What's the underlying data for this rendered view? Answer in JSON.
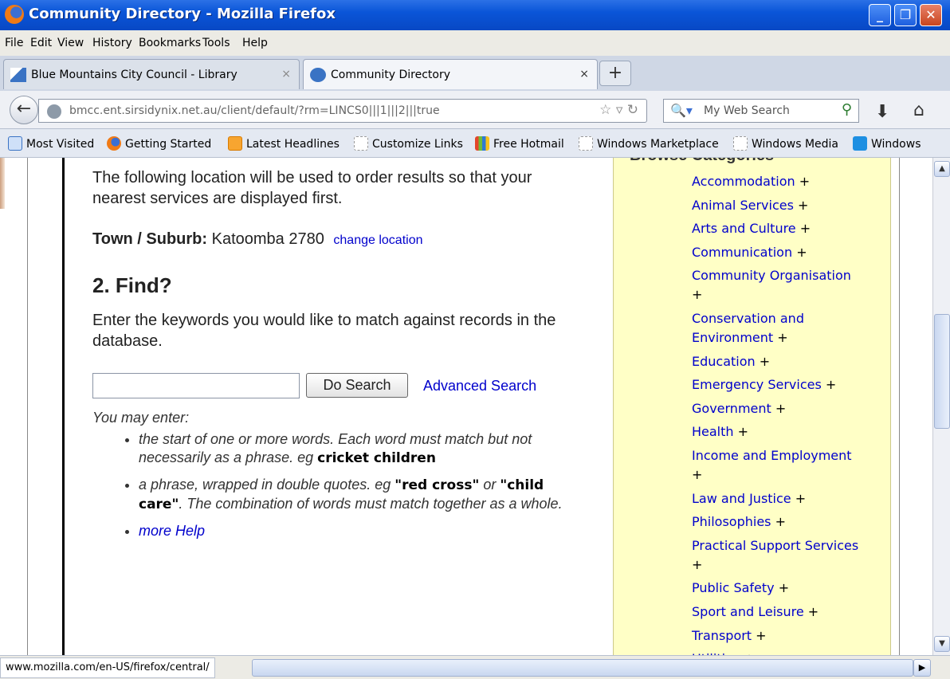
{
  "window": {
    "title": "Community Directory - Mozilla Firefox"
  },
  "menu": [
    "File",
    "Edit",
    "View",
    "History",
    "Bookmarks",
    "Tools",
    "Help"
  ],
  "tabs": [
    {
      "label": "Blue Mountains City Council - Library"
    },
    {
      "label": "Community Directory"
    }
  ],
  "nav": {
    "url": "bmcc.ent.sirsidynix.net.au/client/default/?rm=LINCS0|||1|||2|||true",
    "search_placeholder": "My Web Search"
  },
  "bookmarks": [
    "Most Visited",
    "Getting Started",
    "Latest Headlines",
    "Customize Links",
    "Free Hotmail",
    "Windows Marketplace",
    "Windows Media",
    "Windows"
  ],
  "main": {
    "intro": "The following location will be used to order results so that your nearest services are displayed first.",
    "town_label": "Town / Suburb:",
    "town_value": "Katoomba 2780",
    "change_location": "change location",
    "find_heading": "2. Find?",
    "find_text": "Enter the keywords you would like to match against records in the database.",
    "search_value": "",
    "do_search": "Do Search",
    "advanced": "Advanced Search",
    "you_may_enter": "You may enter:",
    "help": {
      "b1_text": "the start of one or more words. Each word must match but not necessarily as a phrase. eg ",
      "b1_example": "cricket children",
      "b2_text": "a phrase, wrapped in double quotes. eg ",
      "b2_ex1": "\"red cross\"",
      "b2_or": " or ",
      "b2_ex2": "\"child care\"",
      "b2_tail": ". The combination of words must match together as a whole.",
      "more_help": "more Help"
    }
  },
  "categories": {
    "heading": "Browse Categories",
    "items": [
      "Accommodation",
      "Animal Services",
      "Arts and Culture",
      "Communication",
      "Community Organisation",
      "Conservation and Environment",
      "Education",
      "Emergency Services",
      "Government",
      "Health",
      "Income and Employment",
      "Law and Justice",
      "Philosophies",
      "Practical Support Services",
      "Public Safety",
      "Sport and Leisure",
      "Transport",
      "Utilities"
    ],
    "plus": "+"
  },
  "status": {
    "url": "www.mozilla.com/en-US/firefox/central/"
  },
  "colors": {
    "link": "#0000cc",
    "sidebar_bg": "#ffffc6",
    "titlebar": "#0a55d8"
  }
}
